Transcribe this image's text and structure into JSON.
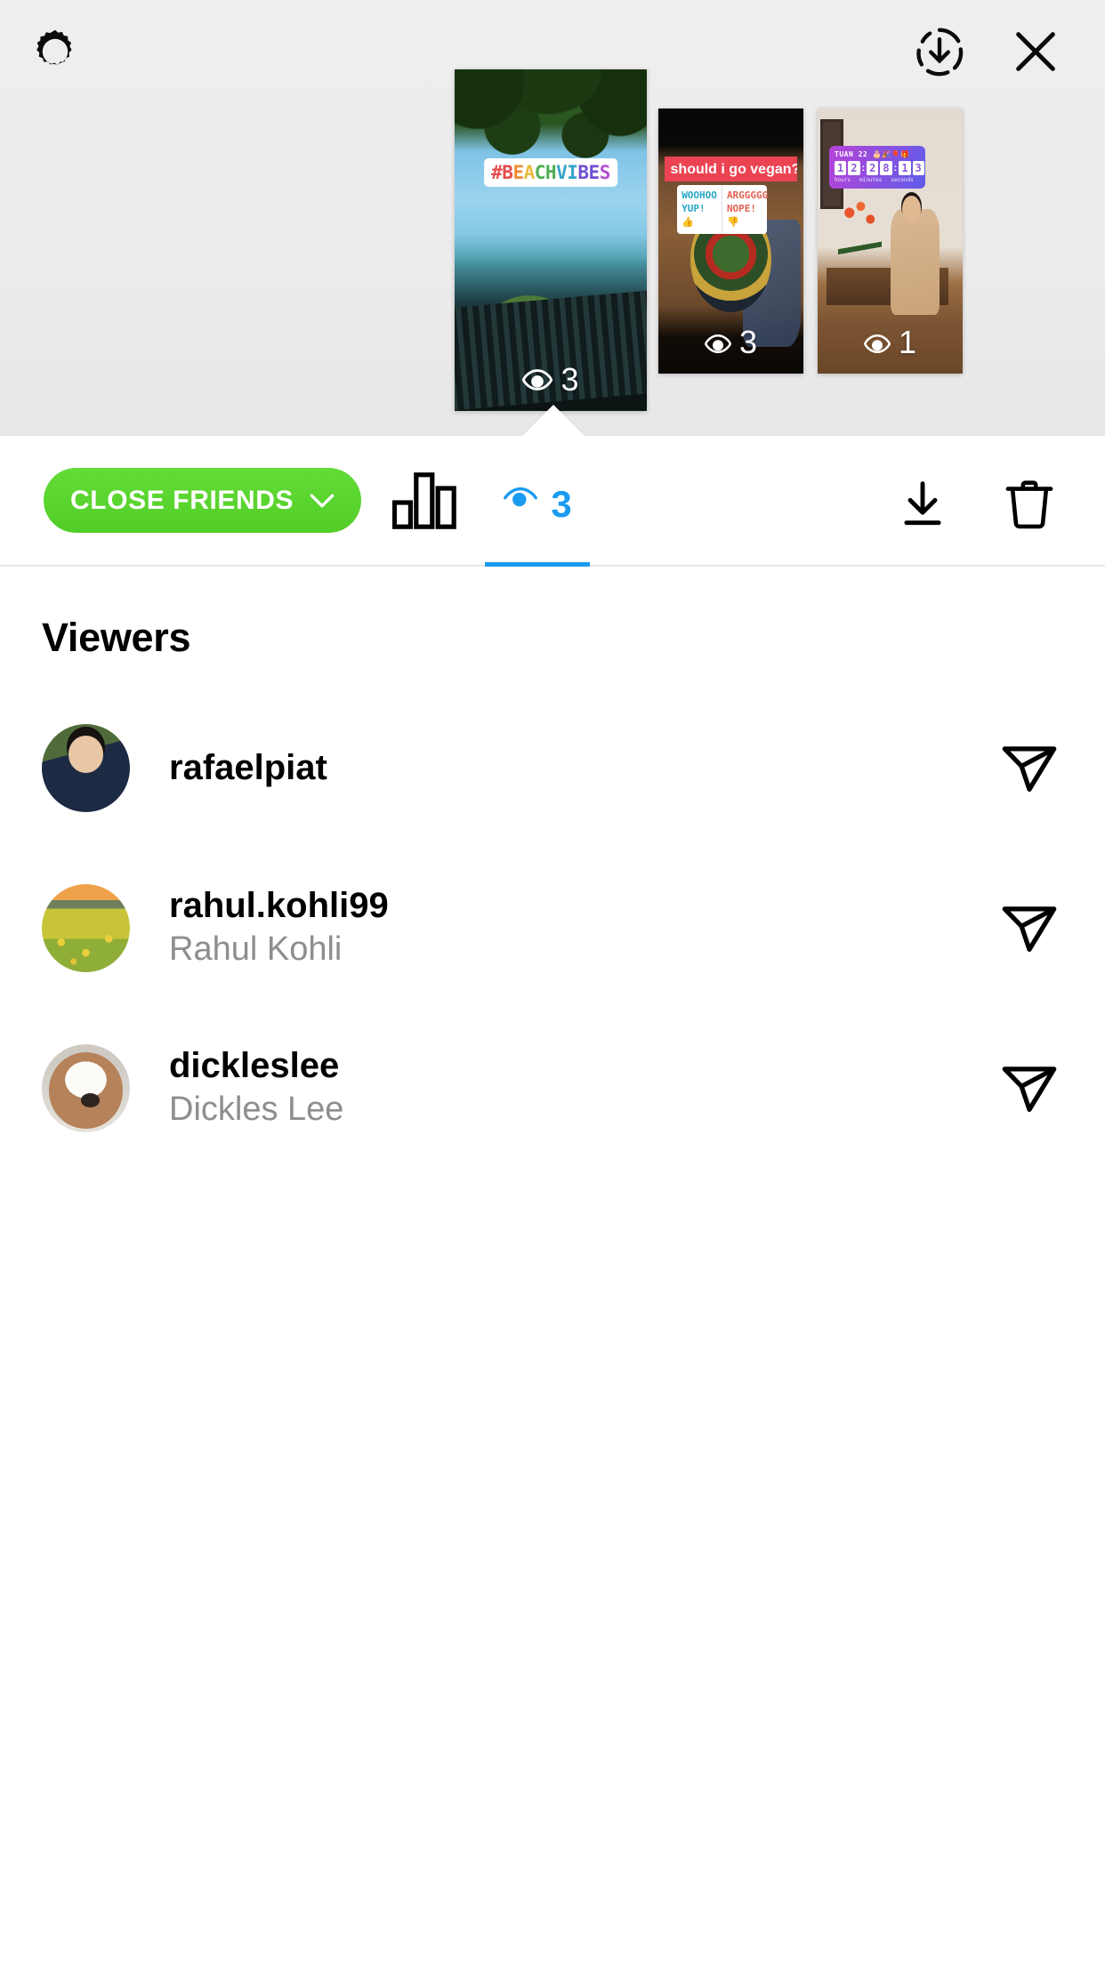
{
  "header": {
    "settings_icon": "gear-icon",
    "download_all_icon": "download-circle-icon",
    "close_icon": "close-icon"
  },
  "stories": [
    {
      "id": "story-1",
      "selected": true,
      "view_count": "3",
      "view_icon": "eye-icon",
      "sticker_type": "hashtag",
      "hashtag_parts": [
        "#",
        "B",
        "E",
        "A",
        "C",
        "H",
        "V",
        "I",
        "B",
        "E",
        "S"
      ],
      "hashtag_text": "#BEACHVIBES",
      "alt": "beach-view-with-trees-and-balcony-railing"
    },
    {
      "id": "story-2",
      "selected": false,
      "view_count": "3",
      "view_icon": "eye-icon",
      "sticker_type": "poll",
      "poll_question": "should i go vegan? 😂",
      "poll_options": [
        "WOOHOO YUP! 👍",
        "ARGGGGG NOPE! 👎"
      ],
      "poll_option_line1": [
        "WOOHOO",
        "ARGGGGG"
      ],
      "poll_option_line2": [
        "YUP! 👍",
        "NOPE! 👎"
      ],
      "alt": "vegan-food-bowl-on-wooden-table"
    },
    {
      "id": "story-3",
      "selected": false,
      "view_count": "1",
      "view_icon": "eye-icon",
      "sticker_type": "countdown",
      "countdown_title": "TUAN 22 🎂🎉🎈🎁",
      "countdown_digits": [
        "1",
        "2",
        "2",
        "8",
        "1",
        "3"
      ],
      "countdown_labels": [
        "hours",
        "minutes",
        "seconds"
      ],
      "countdown_display": "12:28:13",
      "alt": "person-sitting-on-bench-with-flowers"
    }
  ],
  "toolbar": {
    "audience_label": "CLOSE FRIENDS",
    "audience_chevron_icon": "chevron-down-icon",
    "insights_icon": "bar-chart-icon",
    "views_icon": "eye-icon",
    "views_count": "3",
    "download_icon": "download-icon",
    "delete_icon": "trash-icon",
    "accent_color": "#1a9bf0",
    "close_friends_color": "#58d62e"
  },
  "viewers_section": {
    "title": "Viewers",
    "viewers": [
      {
        "username": "rafaelpiat",
        "display_name": "",
        "send_icon": "send-icon",
        "avatar": "man-in-suit"
      },
      {
        "username": "rahul.kohli99",
        "display_name": "Rahul Kohli",
        "send_icon": "send-icon",
        "avatar": "sunflower-field"
      },
      {
        "username": "dickleslee",
        "display_name": "Dickles Lee",
        "send_icon": "send-icon",
        "avatar": "dog-face"
      }
    ]
  }
}
